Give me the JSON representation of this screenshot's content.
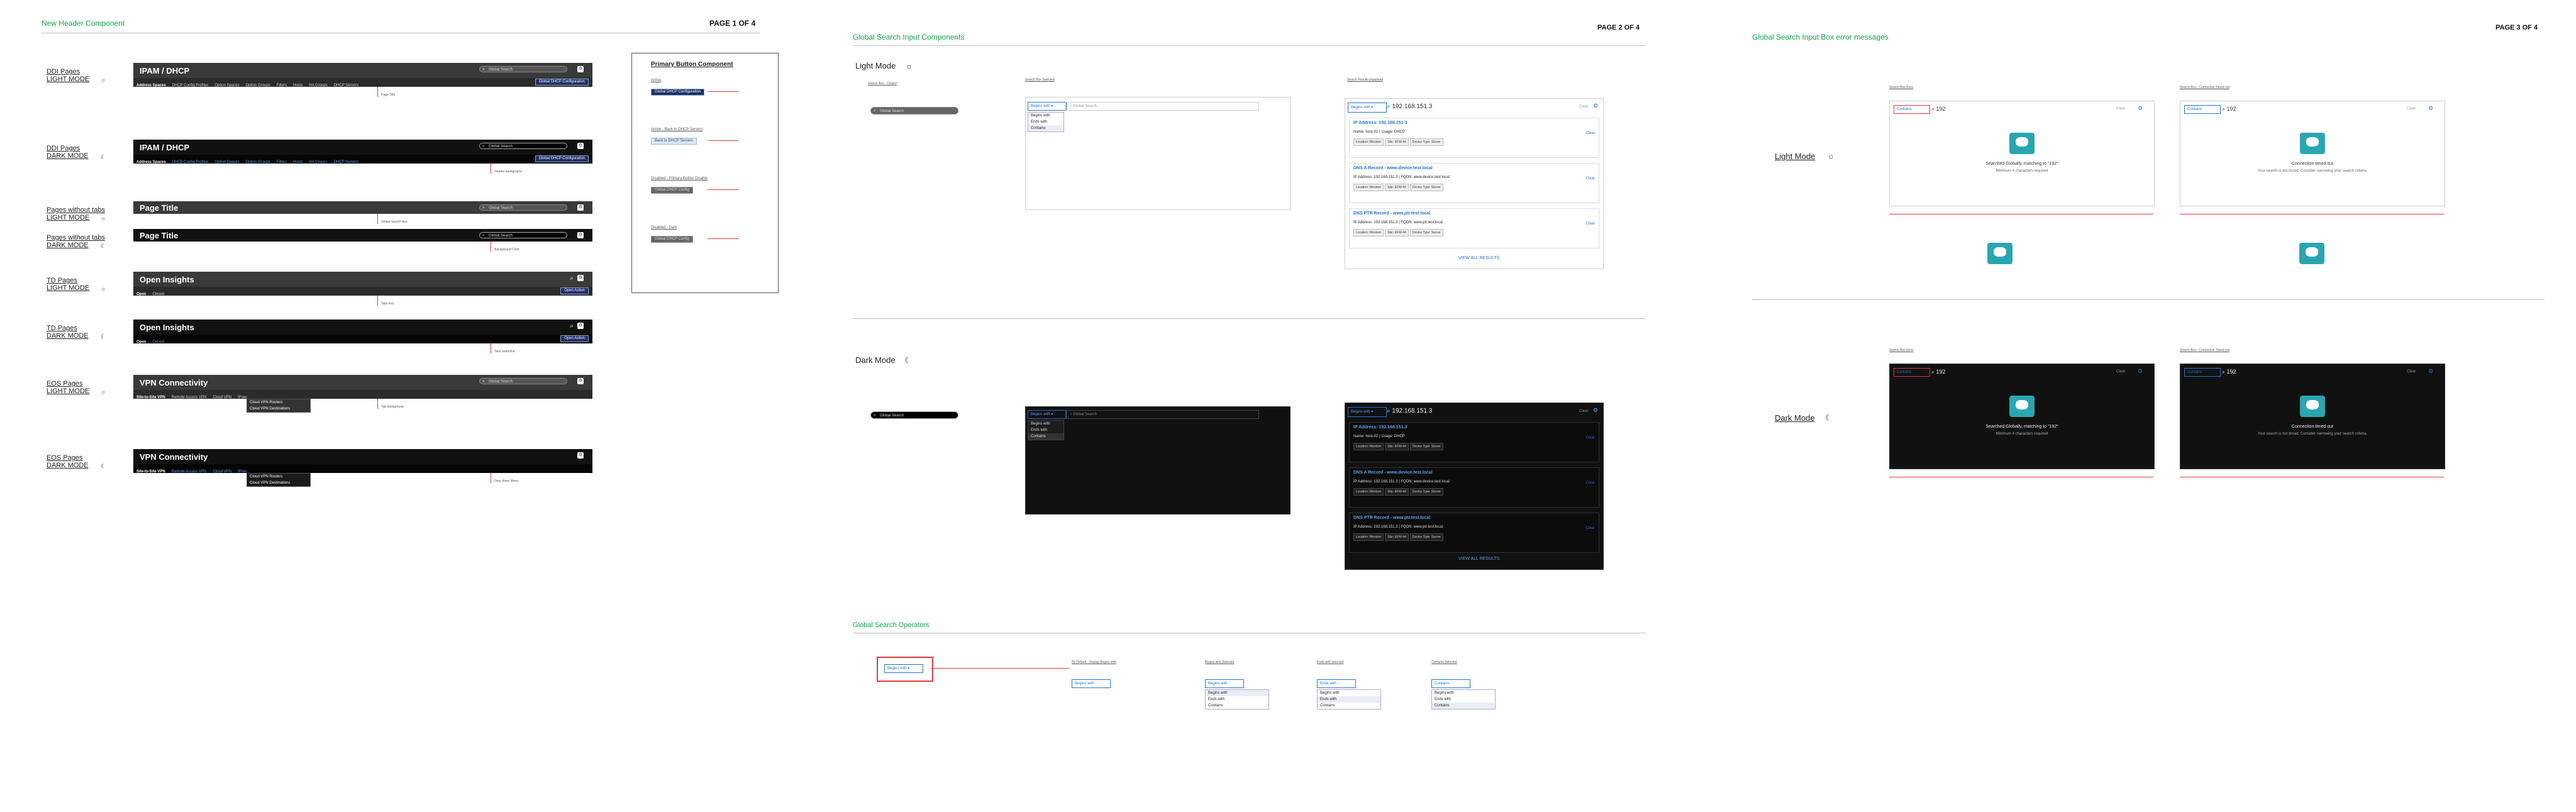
{
  "pages": [
    {
      "title": "New Header Component",
      "number": "PAGE 1 OF 4"
    },
    {
      "title": "Global Search Input Components",
      "number": "PAGE 2 OF 4"
    },
    {
      "title": "Global Search Input Box error messages",
      "number": "PAGE 3 OF 4"
    }
  ],
  "page1": {
    "rows": [
      {
        "label": "DDI Pages\nLIGHT MODE",
        "header_title": "IPAM / DHCP",
        "dark": false,
        "tabs": [
          "Address Spaces",
          "DHCP Config Profiles",
          "Option Spaces",
          "Option Groups",
          "Filters",
          "Hosts",
          "HA Groups",
          "DHCP Servers"
        ],
        "search": "Global Search",
        "action": "Global DHCP Configuration"
      },
      {
        "label": "DDI Pages\nDARK MODE",
        "header_title": "IPAM / DHCP",
        "dark": true,
        "tabs": [
          "Address Spaces",
          "DHCP Config Profiles",
          "Option Spaces",
          "Option Groups",
          "Filters",
          "Hosts",
          "HA Groups",
          "DHCP Servers"
        ],
        "search": "Global Search",
        "action": "Global DHCP Configuration"
      },
      {
        "label": "Pages without tabs\nLIGHT MODE",
        "header_title": "Page Title",
        "dark": false,
        "search": "Global Search"
      },
      {
        "label": "Pages without tabs\nDARK MODE",
        "header_title": "Page Title",
        "dark": true,
        "search": "Global Search"
      },
      {
        "label": "TD Pages\nLIGHT MODE",
        "header_title": "Open Insights",
        "dark": false,
        "tabs": [
          "Open",
          "Closed"
        ],
        "action": "Open Action"
      },
      {
        "label": "TD Pages\nDARK MODE",
        "header_title": "Open Insights",
        "dark": true,
        "tabs": [
          "Open",
          "Closed"
        ],
        "action": "Open Action"
      },
      {
        "label": "EOS Pages\nLIGHT MODE",
        "header_title": "VPN Connectivity",
        "dark": false,
        "tabs": [
          "Site-to-Site VPN",
          "Remote Access VPN",
          "Cloud VPN",
          "IPsec"
        ],
        "search": "Global Search",
        "menu": [
          "Cloud VPN Routers",
          "Cloud VPN Destinations"
        ]
      },
      {
        "label": "EOS Pages\nDARK MODE",
        "header_title": "VPN Connectivity",
        "dark": true,
        "tabs": [
          "Site-to-Site VPN",
          "Remote Access VPN",
          "Cloud VPN",
          "IPsec"
        ],
        "menu": [
          "Cloud VPN Routers",
          "Cloud VPN Destinations"
        ]
      }
    ],
    "primary_button_panel": {
      "title": "Primary Button Component",
      "states": [
        {
          "name": "Active",
          "button": "Global DHCP Configuration"
        },
        {
          "name": "Active - Back to DHCP Servers",
          "button": "Back to DHCP Servers"
        },
        {
          "name": "Disabled - Primary Button Disable",
          "button": "Global DHCP Config"
        },
        {
          "name": "Disabled - Dark",
          "button": "Global DHCP Config"
        }
      ]
    },
    "margin_notes": [
      "Page Title",
      "Header background",
      "Global Search Box",
      "Background Color",
      "Tabs text",
      "Tabs underline",
      "Tab background",
      "Drop down Menu",
      "Menu background"
    ]
  },
  "page2": {
    "light_mode": "Light Mode",
    "dark_mode": "Dark Mode",
    "col_titles": [
      "Search Box - Closed",
      "Search Box Selected",
      "Search Results populated"
    ],
    "search_closed": "Global Search",
    "search_query": "192.168.151.3",
    "scope": "Begins with",
    "operators": [
      "Begins with",
      "Ends with",
      "Contains"
    ],
    "results": [
      {
        "title": "IP Address: 192.168.151.3",
        "sub": "Name: host-02 | Usage: DHCP",
        "tags": [
          "Location: Western",
          "Site: EFW-44",
          "Device Type: Server"
        ]
      },
      {
        "title": "DNS A Record - www.device.test.local",
        "sub": "IP Address: 192.168.151.3 | FQDN: www.device.test.local",
        "tags": [
          "Location: Western",
          "Site: EFW-44",
          "Device Type: Server"
        ]
      },
      {
        "title": "DNS PTR Record - www.ptr.test.local",
        "sub": "IP Address: 192.168.151.3 | FQDN: www.ptr.test.local",
        "tags": [
          "Location: Western",
          "Site: EFW-44",
          "Device Type: Server"
        ]
      }
    ],
    "view_all": "VIEW ALL RESULTS",
    "clear": "Clear",
    "operators_section": "Global Search Operators",
    "operator_notes": [
      "By Default - Display Begins with",
      "Begins with Selected",
      "Ends with Selected",
      "Contains Selected"
    ],
    "operator_labels": [
      "Begins with",
      "Begins with",
      "Ends with",
      "Contains"
    ]
  },
  "page3": {
    "light_mode": "Light Mode",
    "dark_mode": "Dark Mode",
    "cols": [
      "Search Box Error",
      "Search Box - Connection Timed out"
    ],
    "query": "192",
    "scope": "Contains",
    "error_title": "Searched Globally, matching to \"192\"",
    "error_sub": "Minimum 4 characters required",
    "timeout_title": "Connection timed out",
    "timeout_sub": "Your search is too broad. Consider narrowing your search criteria.",
    "clear": "Clear"
  },
  "colors": {
    "green": "#12a44a",
    "header_light": "#3a3a3a",
    "header_dark": "#111111",
    "annotation": "#e23b3b",
    "link": "#2374d0",
    "button": "#1f2f6a"
  }
}
